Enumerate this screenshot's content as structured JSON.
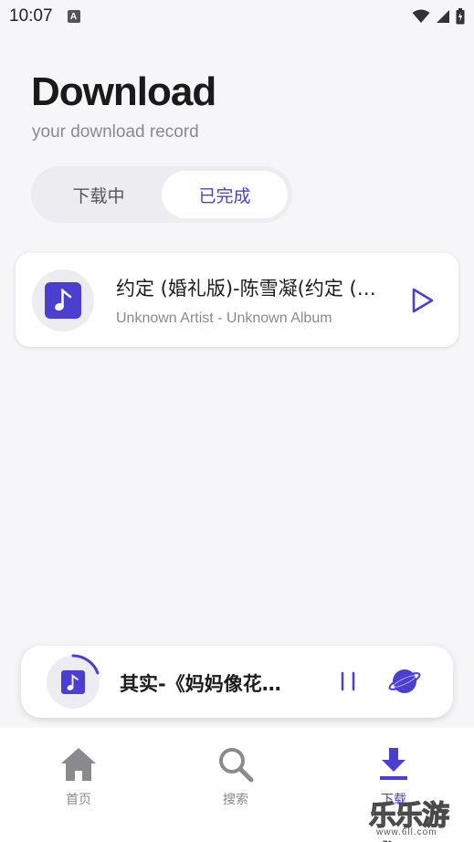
{
  "status_bar": {
    "time": "10:07",
    "indicator": "A"
  },
  "header": {
    "title": "Download",
    "subtitle": "your download record"
  },
  "tabs": [
    {
      "label": "下载中",
      "active": false
    },
    {
      "label": "已完成",
      "active": true
    }
  ],
  "song_card": {
    "title": "约定 (婚礼版)-陈雪凝(约定 (…",
    "subtitle": "Unknown Artist - Unknown Album",
    "icon": "music-note-icon"
  },
  "mini_player": {
    "title": "其实-《妈妈像花…",
    "state": "playing"
  },
  "bottom_nav": [
    {
      "label": "首页",
      "icon": "home-icon",
      "active": false
    },
    {
      "label": "搜索",
      "icon": "search-icon",
      "active": false
    },
    {
      "label": "下载",
      "icon": "download-icon",
      "active": true
    }
  ],
  "watermark": {
    "text": "乐乐游戏",
    "url": "www.6ll.com"
  },
  "colors": {
    "accent": "#4a3fd0",
    "background": "#f6f6f9",
    "muted": "#8a8a8e"
  }
}
